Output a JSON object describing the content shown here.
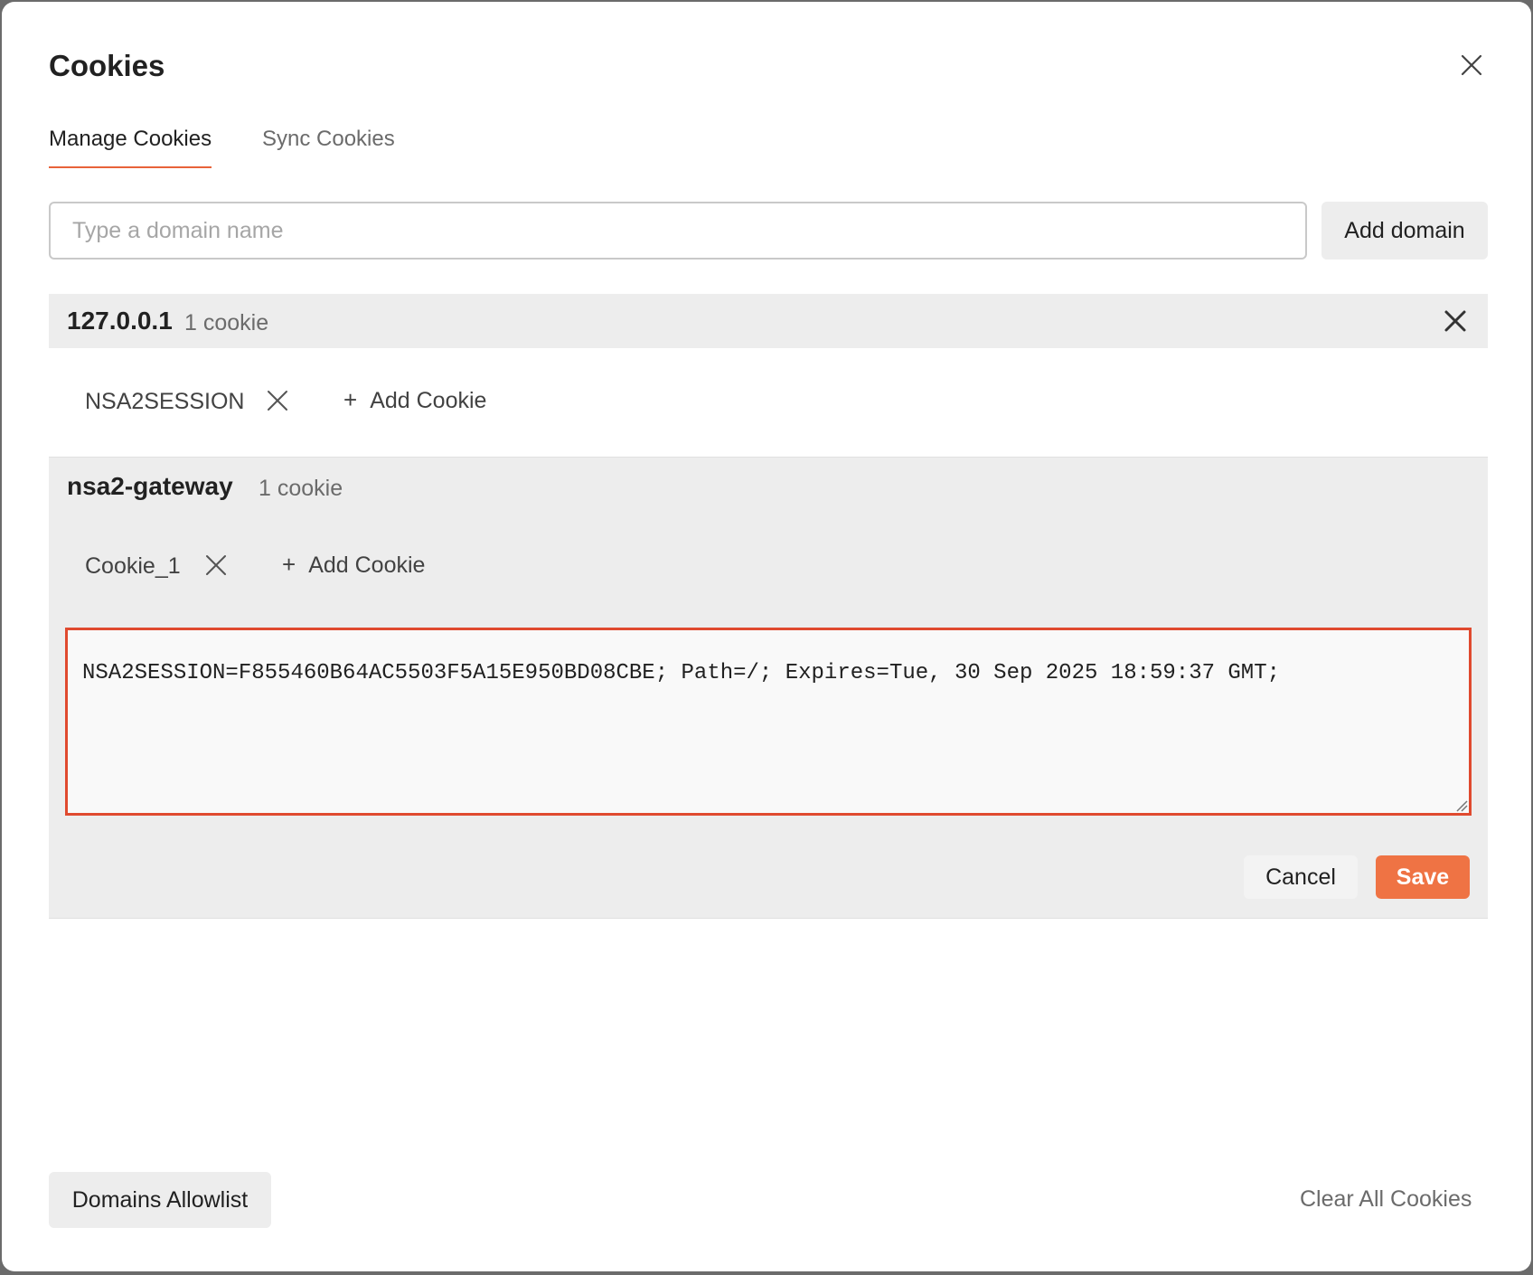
{
  "dialog": {
    "title": "Cookies",
    "close_icon": "close-icon"
  },
  "tabs": [
    {
      "label": "Manage Cookies",
      "active": true
    },
    {
      "label": "Sync Cookies",
      "active": false
    }
  ],
  "domain_input": {
    "value": "",
    "placeholder": "Type a domain name"
  },
  "add_domain_label": "Add domain",
  "domains": [
    {
      "name": "127.0.0.1",
      "count": "1 cookie",
      "cookies": [
        "NSA2SESSION"
      ],
      "add_cookie_label": "Add Cookie"
    },
    {
      "name": "nsa2-gateway",
      "count": "1 cookie",
      "cookies": [
        "Cookie_1"
      ],
      "add_cookie_label": "Add Cookie",
      "editor_value": "NSA2SESSION=F855460B64AC5503F5A15E950BD08CBE; Path=/; Expires=Tue, 30 Sep 2025 18:59:37 GMT;",
      "cancel_label": "Cancel",
      "save_label": "Save"
    }
  ],
  "footer": {
    "allowlist_label": "Domains Allowlist",
    "clear_all_label": "Clear All Cookies"
  },
  "colors": {
    "accent": "#ef7344",
    "highlight_border": "#e04a2f",
    "section_bg": "#ededed"
  }
}
